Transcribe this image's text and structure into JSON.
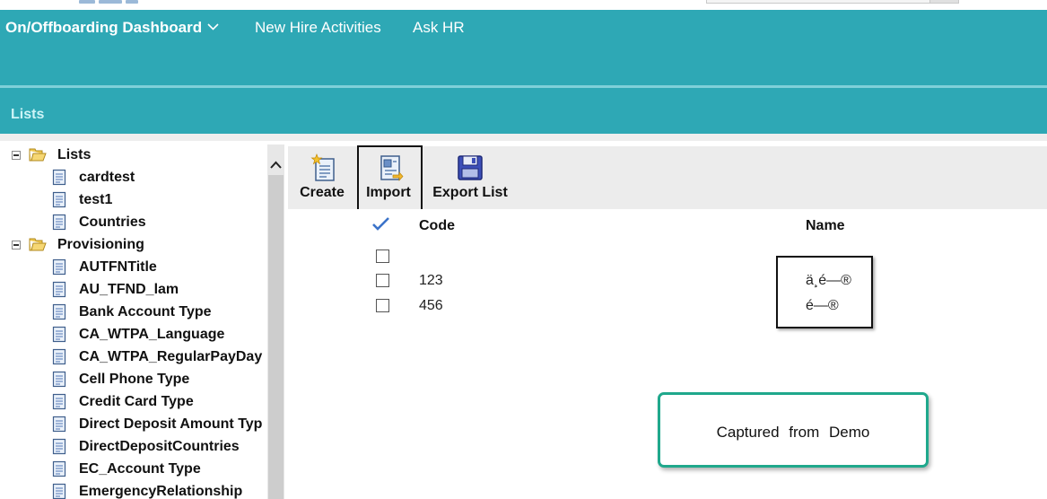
{
  "header": {
    "nav": [
      {
        "label": "On/Offboarding Dashboard"
      },
      {
        "label": "New Hire Activities"
      },
      {
        "label": "Ask HR"
      }
    ],
    "subtab": "Lists"
  },
  "tree": {
    "groups": [
      {
        "label": "Lists",
        "items": [
          "cardtest",
          "test1",
          "Countries"
        ]
      },
      {
        "label": "Provisioning",
        "items": [
          "AUTFNTitle",
          "AU_TFND_lam",
          "Bank Account Type",
          "CA_WTPA_Language",
          "CA_WTPA_RegularPayDay",
          "Cell Phone Type",
          "Credit Card Type",
          "Direct Deposit Amount Typ",
          "DirectDepositCountries",
          "EC_Account Type",
          "EmergencyRelationship"
        ]
      }
    ],
    "selected": "test1"
  },
  "toolbar": {
    "create_label": "Create",
    "import_label": "Import",
    "export_label": "Export List"
  },
  "grid": {
    "columns": [
      "Code",
      "Name"
    ],
    "rows": [
      {
        "code": "",
        "name": ""
      },
      {
        "code": "123",
        "name": "ä¸é—®"
      },
      {
        "code": "456",
        "name": "é—®"
      }
    ]
  },
  "callout": {
    "text": "Captured from Demo"
  },
  "colors": {
    "header": "#2ea8b5",
    "callout_border": "#1fa88c"
  }
}
